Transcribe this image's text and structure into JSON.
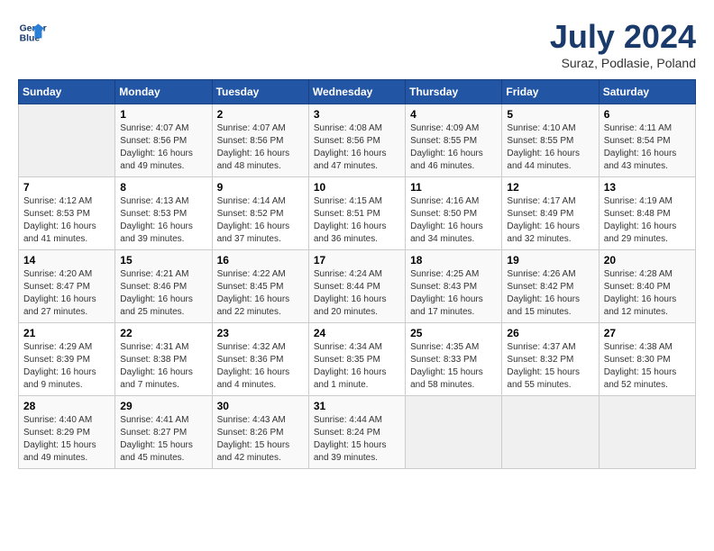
{
  "header": {
    "logo_line1": "General",
    "logo_line2": "Blue",
    "month": "July 2024",
    "location": "Suraz, Podlasie, Poland"
  },
  "weekdays": [
    "Sunday",
    "Monday",
    "Tuesday",
    "Wednesday",
    "Thursday",
    "Friday",
    "Saturday"
  ],
  "weeks": [
    [
      {
        "day": "",
        "info": ""
      },
      {
        "day": "1",
        "info": "Sunrise: 4:07 AM\nSunset: 8:56 PM\nDaylight: 16 hours\nand 49 minutes."
      },
      {
        "day": "2",
        "info": "Sunrise: 4:07 AM\nSunset: 8:56 PM\nDaylight: 16 hours\nand 48 minutes."
      },
      {
        "day": "3",
        "info": "Sunrise: 4:08 AM\nSunset: 8:56 PM\nDaylight: 16 hours\nand 47 minutes."
      },
      {
        "day": "4",
        "info": "Sunrise: 4:09 AM\nSunset: 8:55 PM\nDaylight: 16 hours\nand 46 minutes."
      },
      {
        "day": "5",
        "info": "Sunrise: 4:10 AM\nSunset: 8:55 PM\nDaylight: 16 hours\nand 44 minutes."
      },
      {
        "day": "6",
        "info": "Sunrise: 4:11 AM\nSunset: 8:54 PM\nDaylight: 16 hours\nand 43 minutes."
      }
    ],
    [
      {
        "day": "7",
        "info": "Sunrise: 4:12 AM\nSunset: 8:53 PM\nDaylight: 16 hours\nand 41 minutes."
      },
      {
        "day": "8",
        "info": "Sunrise: 4:13 AM\nSunset: 8:53 PM\nDaylight: 16 hours\nand 39 minutes."
      },
      {
        "day": "9",
        "info": "Sunrise: 4:14 AM\nSunset: 8:52 PM\nDaylight: 16 hours\nand 37 minutes."
      },
      {
        "day": "10",
        "info": "Sunrise: 4:15 AM\nSunset: 8:51 PM\nDaylight: 16 hours\nand 36 minutes."
      },
      {
        "day": "11",
        "info": "Sunrise: 4:16 AM\nSunset: 8:50 PM\nDaylight: 16 hours\nand 34 minutes."
      },
      {
        "day": "12",
        "info": "Sunrise: 4:17 AM\nSunset: 8:49 PM\nDaylight: 16 hours\nand 32 minutes."
      },
      {
        "day": "13",
        "info": "Sunrise: 4:19 AM\nSunset: 8:48 PM\nDaylight: 16 hours\nand 29 minutes."
      }
    ],
    [
      {
        "day": "14",
        "info": "Sunrise: 4:20 AM\nSunset: 8:47 PM\nDaylight: 16 hours\nand 27 minutes."
      },
      {
        "day": "15",
        "info": "Sunrise: 4:21 AM\nSunset: 8:46 PM\nDaylight: 16 hours\nand 25 minutes."
      },
      {
        "day": "16",
        "info": "Sunrise: 4:22 AM\nSunset: 8:45 PM\nDaylight: 16 hours\nand 22 minutes."
      },
      {
        "day": "17",
        "info": "Sunrise: 4:24 AM\nSunset: 8:44 PM\nDaylight: 16 hours\nand 20 minutes."
      },
      {
        "day": "18",
        "info": "Sunrise: 4:25 AM\nSunset: 8:43 PM\nDaylight: 16 hours\nand 17 minutes."
      },
      {
        "day": "19",
        "info": "Sunrise: 4:26 AM\nSunset: 8:42 PM\nDaylight: 16 hours\nand 15 minutes."
      },
      {
        "day": "20",
        "info": "Sunrise: 4:28 AM\nSunset: 8:40 PM\nDaylight: 16 hours\nand 12 minutes."
      }
    ],
    [
      {
        "day": "21",
        "info": "Sunrise: 4:29 AM\nSunset: 8:39 PM\nDaylight: 16 hours\nand 9 minutes."
      },
      {
        "day": "22",
        "info": "Sunrise: 4:31 AM\nSunset: 8:38 PM\nDaylight: 16 hours\nand 7 minutes."
      },
      {
        "day": "23",
        "info": "Sunrise: 4:32 AM\nSunset: 8:36 PM\nDaylight: 16 hours\nand 4 minutes."
      },
      {
        "day": "24",
        "info": "Sunrise: 4:34 AM\nSunset: 8:35 PM\nDaylight: 16 hours\nand 1 minute."
      },
      {
        "day": "25",
        "info": "Sunrise: 4:35 AM\nSunset: 8:33 PM\nDaylight: 15 hours\nand 58 minutes."
      },
      {
        "day": "26",
        "info": "Sunrise: 4:37 AM\nSunset: 8:32 PM\nDaylight: 15 hours\nand 55 minutes."
      },
      {
        "day": "27",
        "info": "Sunrise: 4:38 AM\nSunset: 8:30 PM\nDaylight: 15 hours\nand 52 minutes."
      }
    ],
    [
      {
        "day": "28",
        "info": "Sunrise: 4:40 AM\nSunset: 8:29 PM\nDaylight: 15 hours\nand 49 minutes."
      },
      {
        "day": "29",
        "info": "Sunrise: 4:41 AM\nSunset: 8:27 PM\nDaylight: 15 hours\nand 45 minutes."
      },
      {
        "day": "30",
        "info": "Sunrise: 4:43 AM\nSunset: 8:26 PM\nDaylight: 15 hours\nand 42 minutes."
      },
      {
        "day": "31",
        "info": "Sunrise: 4:44 AM\nSunset: 8:24 PM\nDaylight: 15 hours\nand 39 minutes."
      },
      {
        "day": "",
        "info": ""
      },
      {
        "day": "",
        "info": ""
      },
      {
        "day": "",
        "info": ""
      }
    ]
  ]
}
